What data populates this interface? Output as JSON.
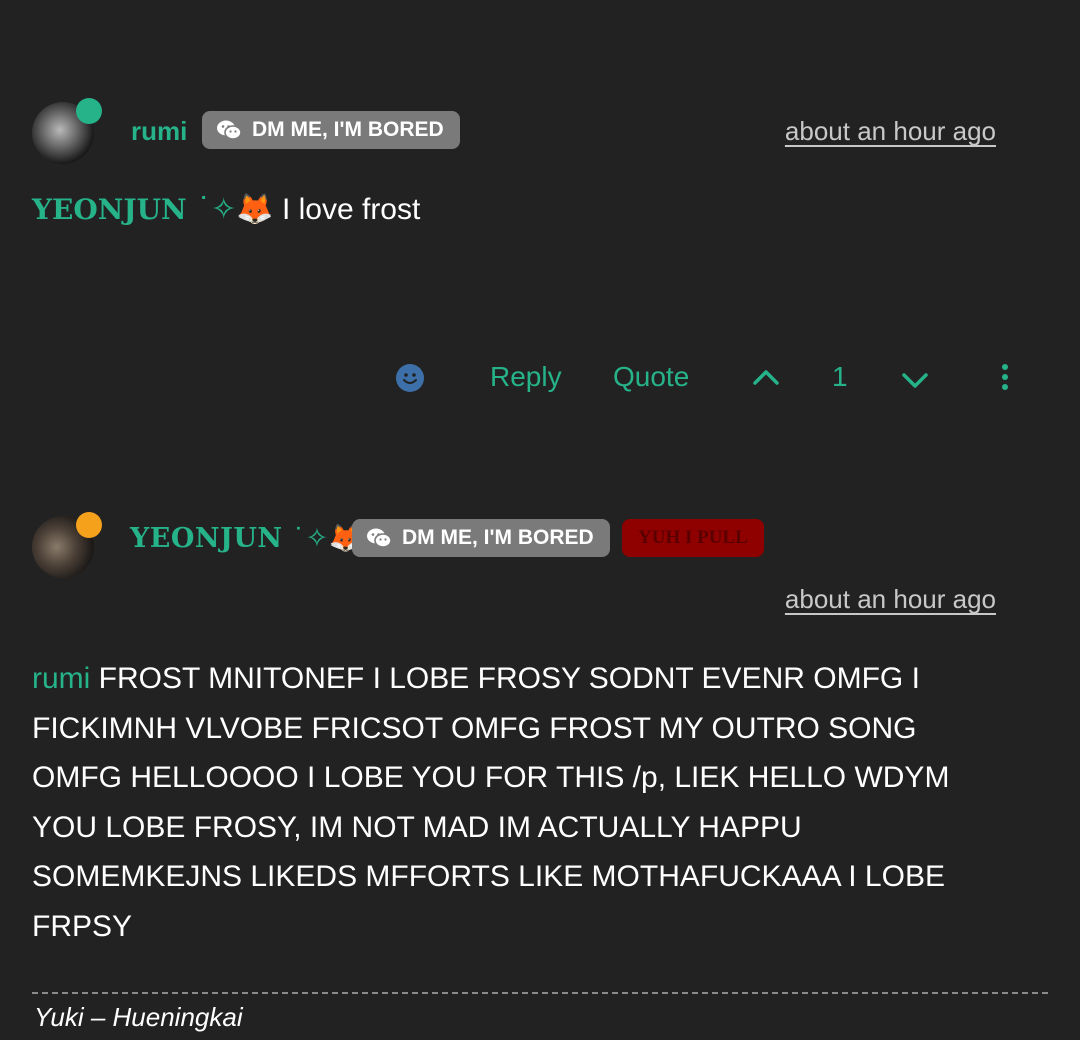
{
  "comments": [
    {
      "author": "rumi",
      "badge": "DM ME, I'M BORED",
      "timestamp": "about an hour ago",
      "mention": "YEONJUN",
      "mention_deco": " ˙✧🦊",
      "text": " I love frost",
      "status_color": "#26b38a",
      "actions": {
        "reply": "Reply",
        "quote": "Quote",
        "vote_count": "1"
      }
    },
    {
      "author": "YEONJUN",
      "author_deco": " ˙✧🦊",
      "badge": "DM ME, I'M BORED",
      "badge2": "YUH I PULL",
      "timestamp": "about an hour ago",
      "mention": "rumi",
      "status_color": "#f5a11c",
      "lines": [
        " FROST MNITONEF I LOBE FROSY SODNT EVENR OMFG I",
        "FICKIMNH VLVOBE FRICSOT OMFG FROST MY OUTRO SONG",
        "OMFG HELLOOOO I LOBE YOU FOR THIS /p, LIEK HELLO WDYM",
        "YOU LOBE FROSY, IM NOT MAD IM ACTUALLY HAPPU",
        "SOMEMKEJNS LIKEDS MFFORTS LIKE MOTHAFUCKAAA I LOBE",
        "FRPSY"
      ],
      "signature": "Yuki – Hueningkai"
    }
  ],
  "colors": {
    "accent": "#26b38a",
    "background": "#222222",
    "badge_gray": "#7a7a7a",
    "badge_red": "#8f0000",
    "emoji_button": "#3d6fa8"
  },
  "icons": {
    "badge_icon": "wechat-icon",
    "react": "smiley-icon",
    "upvote": "chevron-up-icon",
    "downvote": "chevron-down-icon",
    "more": "more-vertical-icon"
  }
}
